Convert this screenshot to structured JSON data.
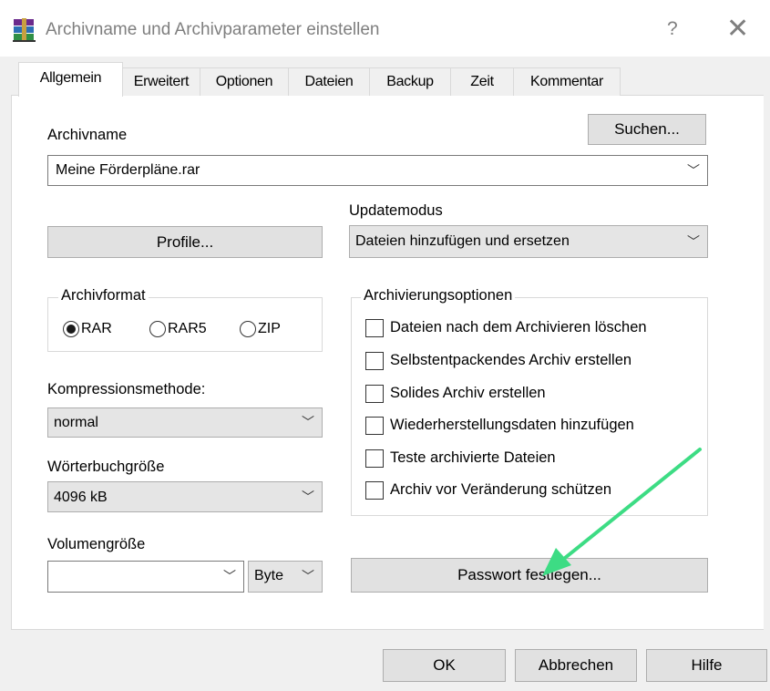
{
  "window": {
    "title": "Archivname und Archivparameter einstellen",
    "help_glyph": "?",
    "close_glyph": "✕"
  },
  "tabs": [
    {
      "label": "Allgemein",
      "active": true
    },
    {
      "label": "Erweitert"
    },
    {
      "label": "Optionen"
    },
    {
      "label": "Dateien"
    },
    {
      "label": "Backup"
    },
    {
      "label": "Zeit"
    },
    {
      "label": "Kommentar"
    }
  ],
  "archive_name": {
    "label": "Archivname",
    "value": "Meine Förderpläne.rar",
    "browse_label": "Suchen..."
  },
  "profiles_label": "Profile...",
  "update_mode": {
    "label": "Updatemodus",
    "value": "Dateien hinzufügen und ersetzen"
  },
  "archive_format": {
    "legend": "Archivformat",
    "options": [
      {
        "label": "RAR",
        "checked": true
      },
      {
        "label": "RAR5",
        "checked": false
      },
      {
        "label": "ZIP",
        "checked": false
      }
    ]
  },
  "compression": {
    "label": "Kompressionsmethode:",
    "value": "normal"
  },
  "dictionary": {
    "label": "Wörterbuchgröße",
    "value": "4096 kB"
  },
  "volume": {
    "label": "Volumengröße",
    "value": "",
    "unit": "Byte"
  },
  "options_group": {
    "legend": "Archivierungsoptionen",
    "items": [
      {
        "label": "Dateien nach dem Archivieren löschen",
        "checked": false
      },
      {
        "label": "Selbstentpackendes Archiv erstellen",
        "checked": false
      },
      {
        "label": "Solides Archiv erstellen",
        "checked": false
      },
      {
        "label": "Wiederherstellungsdaten hinzufügen",
        "checked": false
      },
      {
        "label": "Teste archivierte Dateien",
        "checked": false
      },
      {
        "label": "Archiv vor Veränderung schützen",
        "checked": false
      }
    ]
  },
  "password_label": "Passwort festlegen...",
  "footer": {
    "ok": "OK",
    "cancel": "Abbrechen",
    "help": "Hilfe"
  },
  "annotation": {
    "arrow_color": "#3ddc84"
  },
  "icons": {
    "app": "winrar-books-icon",
    "chevron": "chevron-down-icon"
  }
}
